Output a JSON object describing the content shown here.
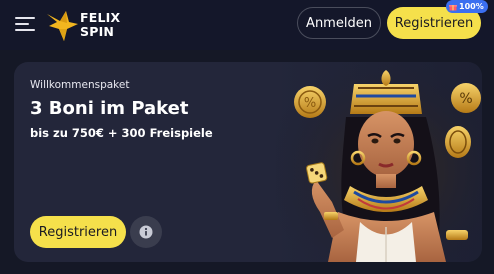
{
  "header": {
    "logo_line1": "FELIX",
    "logo_line2": "SPIN",
    "login_label": "Anmelden",
    "register_label": "Registrieren",
    "badge_text": "100%",
    "badge_icon": "gift-icon"
  },
  "promo": {
    "kicker": "Willkommenspaket",
    "headline": "3 Boni im Paket",
    "subline": "bis zu 750€ + 300 Freispiele",
    "register_label": "Registrieren",
    "info_icon": "info-icon",
    "art": "cleopatra-illustration"
  },
  "colors": {
    "background": "#151826",
    "card": "#23263a",
    "accent_yellow": "#f5e04b",
    "badge_blue": "#3b6ff0"
  }
}
